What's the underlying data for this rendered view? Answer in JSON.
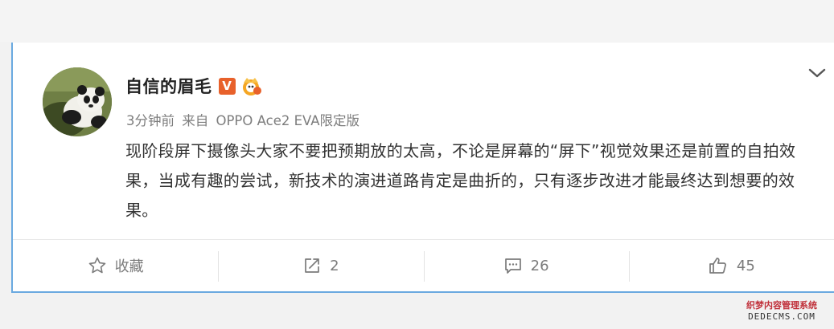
{
  "post": {
    "username": "自信的眉毛",
    "verified_badge": "V",
    "time": "3分钟前",
    "source_prefix": "来自",
    "source_device": "OPPO Ace2 EVA限定版",
    "text": "现阶段屏下摄像头大家不要把预期放的太高，不论是屏幕的“屏下”视觉效果还是前置的自拍效果，当成有趣的尝试，新技术的演进道路肯定是曲折的，只有逐步改进才能最终达到想要的效果。"
  },
  "actions": {
    "favorite_label": "收藏",
    "repost_count": "2",
    "comment_count": "26",
    "like_count": "45"
  },
  "icons": {
    "avatar": "panda-avatar",
    "verified": "verified-v-icon",
    "member": "crown-member-icon",
    "menu": "chevron-down-icon",
    "favorite": "star-icon",
    "repost": "repost-icon",
    "comment": "comment-icon",
    "like": "thumbs-up-icon"
  },
  "colors": {
    "card_border": "#6aa9e0",
    "verified_orange": "#e8612b",
    "meta_gray": "#7d7d7d"
  },
  "watermark": {
    "line1": "织梦内容管理系统",
    "line2": "DEDECMS.COM"
  }
}
